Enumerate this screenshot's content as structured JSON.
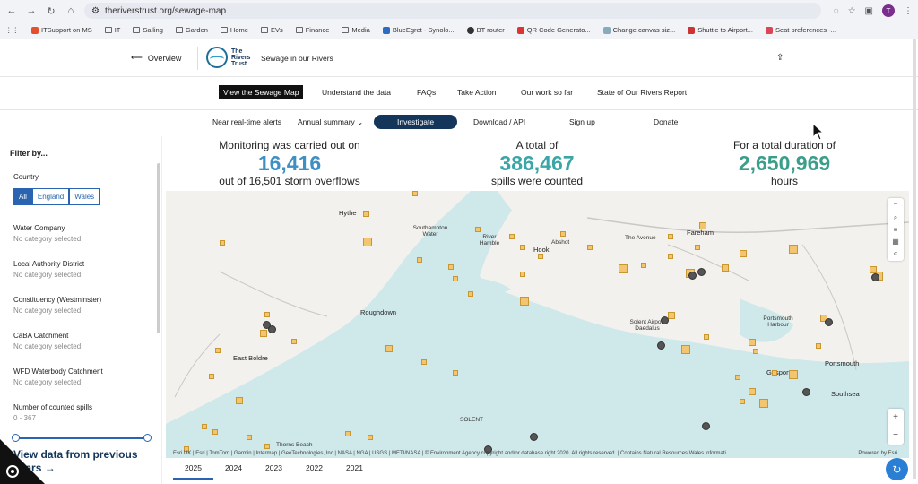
{
  "browser": {
    "url": "theriverstrust.org/sewage-map",
    "profile_initial": "T",
    "bookmarks": [
      "ITSupport on MS",
      "IT",
      "Sailing",
      "Garden",
      "Home",
      "EVs",
      "Finance",
      "Media",
      "BlueEgret - Synolo...",
      "BT router",
      "QR Code Generato...",
      "Change canvas siz...",
      "Shuttle to Airport...",
      "Seat preferences -..."
    ]
  },
  "header": {
    "overview": "Overview",
    "logo_text": "The Rivers Trust",
    "subtitle": "Sewage in our Rivers"
  },
  "nav1": [
    "View the Sewage Map",
    "Understand the data",
    "FAQs",
    "Take Action",
    "Our work so far",
    "State of Our Rivers Report"
  ],
  "nav2": [
    "Near real-time alerts",
    "Annual summary",
    "Investigate",
    "Download / API",
    "Sign up",
    "Donate"
  ],
  "sidebar": {
    "title": "Filter by...",
    "country_label": "Country",
    "country_options": [
      "All",
      "England",
      "Wales"
    ],
    "filters": [
      {
        "label": "Water Company",
        "value": "No category selected"
      },
      {
        "label": "Local Authority District",
        "value": "No category selected"
      },
      {
        "label": "Constituency (Westminster)",
        "value": "No category selected"
      },
      {
        "label": "CaBA Catchment",
        "value": "No category selected"
      },
      {
        "label": "WFD Waterbody Catchment",
        "value": "No category selected"
      },
      {
        "label": "Number of counted spills",
        "value": "0 - 367"
      }
    ],
    "view_prev": "View data from previous years →"
  },
  "stats": [
    {
      "pre": "Monitoring was carried out on",
      "value": "16,416",
      "post": "out of 16,501 storm overflows",
      "color": "#3d8fc4"
    },
    {
      "pre": "A total of",
      "value": "386,467",
      "post": "spills were counted",
      "color": "#3aa6a8"
    },
    {
      "pre": "For a total duration of",
      "value": "2,650,969",
      "post": "hours",
      "color": "#3a9e8a"
    }
  ],
  "map": {
    "places": [
      "Hythe",
      "Southampton Water",
      "River Hamble",
      "Hook",
      "Abshot",
      "Fareham",
      "The Avenue",
      "Roughdown",
      "East Boldre",
      "Solent Airport Daedalus",
      "Portsmouth Harbour",
      "Gosport",
      "Portsmouth",
      "Southsea",
      "Thorns Beach",
      "SOLENT"
    ],
    "attribution": "Esri UK | Esri | TomTom | Garmin | Intermap | GeoTechnologies, Inc | NASA | NGA | USGS | METI/NASA | © Environment Agency copyright and/or database right 2020. All rights reserved. | Contains Natural Resources Wales informati...",
    "powered": "Powered by Esri"
  },
  "years": [
    "2025",
    "2024",
    "2023",
    "2022",
    "2021"
  ]
}
